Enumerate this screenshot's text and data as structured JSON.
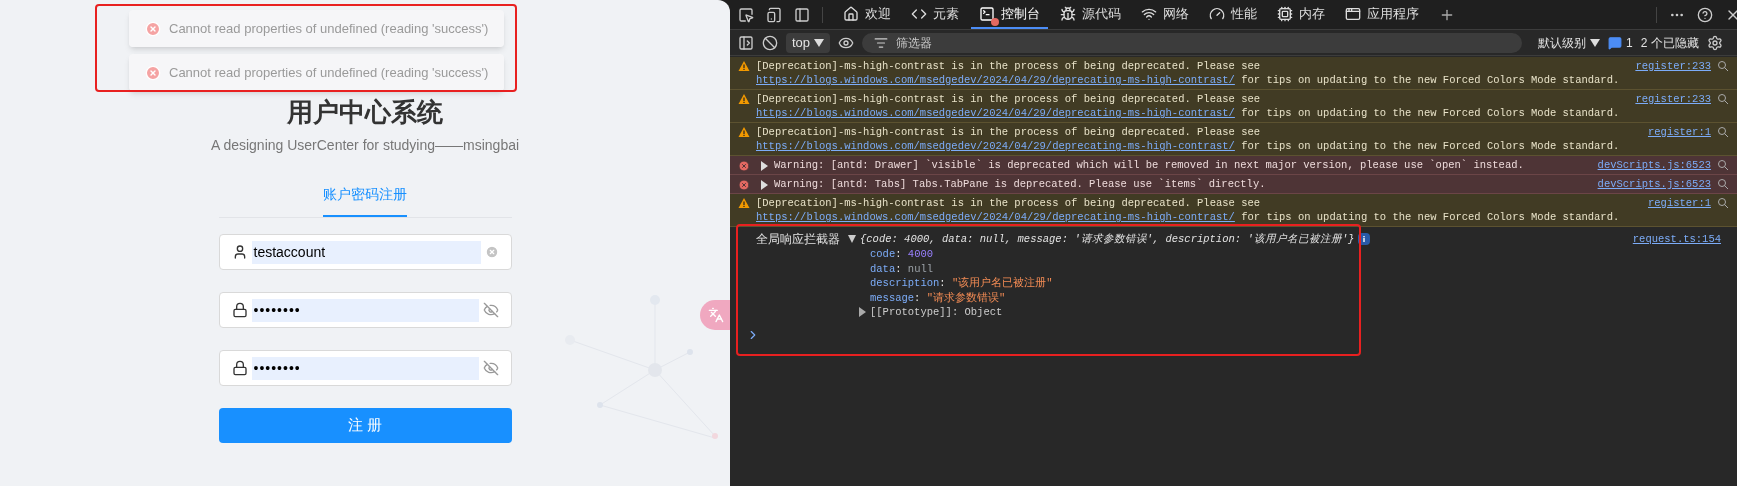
{
  "app": {
    "toasts": [
      {
        "kind": "error",
        "text": "Cannot read properties of undefined (reading 'success')"
      },
      {
        "kind": "error",
        "text": "Cannot read properties of undefined (reading 'success')"
      }
    ],
    "title": "用户中心系统",
    "subtitle": "A designing UserCenter for studying——msingbai",
    "tabs": [
      {
        "label": "账户密码注册",
        "selected": true
      }
    ],
    "fields": [
      {
        "kind": "user",
        "value": "testaccount"
      },
      {
        "kind": "password",
        "value": "••••••••"
      },
      {
        "kind": "password",
        "value": "••••••••"
      }
    ],
    "submit": "注 册"
  },
  "devtools": {
    "tabs": [
      {
        "label": "欢迎",
        "selected": false,
        "alert": false
      },
      {
        "label": "元素",
        "selected": false,
        "alert": false
      },
      {
        "label": "控制台",
        "selected": true,
        "alert": true
      },
      {
        "label": "源代码",
        "selected": false,
        "alert": false
      },
      {
        "label": "网络",
        "selected": false,
        "alert": false
      },
      {
        "label": "性能",
        "selected": false,
        "alert": false
      },
      {
        "label": "内存",
        "selected": false,
        "alert": false
      },
      {
        "label": "应用程序",
        "selected": false,
        "alert": false
      }
    ],
    "context": "top",
    "filter_placeholder": "筛选器",
    "level_menu": "默认级别",
    "issues_count": "1",
    "hidden": "2 个已隐藏",
    "messages": [
      {
        "kind": "warning",
        "text": "[Deprecation]-ms-high-contrast is in the process of being deprecated. Please see",
        "link": "https://blogs.windows.com/msedgedev/2024/04/29/deprecating-ms-high-contrast/",
        "after": " for tips on updating to the new Forced Colors Mode standard.",
        "source": "register:233"
      },
      {
        "kind": "warning",
        "text": "[Deprecation]-ms-high-contrast is in the process of being deprecated. Please see",
        "link": "https://blogs.windows.com/msedgedev/2024/04/29/deprecating-ms-high-contrast/",
        "after": " for tips on updating to the new Forced Colors Mode standard.",
        "source": "register:233"
      },
      {
        "kind": "warning",
        "text": "[Deprecation]-ms-high-contrast is in the process of being deprecated. Please see",
        "link": "https://blogs.windows.com/msedgedev/2024/04/29/deprecating-ms-high-contrast/",
        "after": " for tips on updating to the new Forced Colors Mode standard.",
        "source": "register:1"
      },
      {
        "kind": "error",
        "text": "Warning: [antd: Drawer] `visible` is deprecated which will be removed in next major version, please use `open` instead.",
        "source": "devScripts.js:6523"
      },
      {
        "kind": "error",
        "text": "Warning: [antd: Tabs] Tabs.TabPane is deprecated. Please use `items` directly.",
        "source": "devScripts.js:6523"
      },
      {
        "kind": "warning",
        "text": "[Deprecation]-ms-high-contrast is in the process of being deprecated. Please see",
        "link": "https://blogs.windows.com/msedgedev/2024/04/29/deprecating-ms-high-contrast/",
        "after": " for tips on updating to the new Forced Colors Mode standard.",
        "source": "register:1"
      }
    ],
    "log": {
      "label": "全局响应拦截器",
      "summary": "{code: 4000, data: null, message: '请求参数错误', description: '该用户名已被注册'}",
      "source": "request.ts:154",
      "expanded": true,
      "props": [
        {
          "key": "code",
          "sep": ":",
          "value": "4000",
          "kind": "number"
        },
        {
          "key": "data",
          "sep": ":",
          "value": "null",
          "kind": "null"
        },
        {
          "key": "description",
          "sep": ":",
          "value": "\"该用户名已被注册\"",
          "kind": "string"
        },
        {
          "key": "message",
          "sep": ":",
          "value": "\"请求参数错误\"",
          "kind": "string"
        }
      ],
      "prototype": "[[Prototype]]: Object"
    }
  }
}
